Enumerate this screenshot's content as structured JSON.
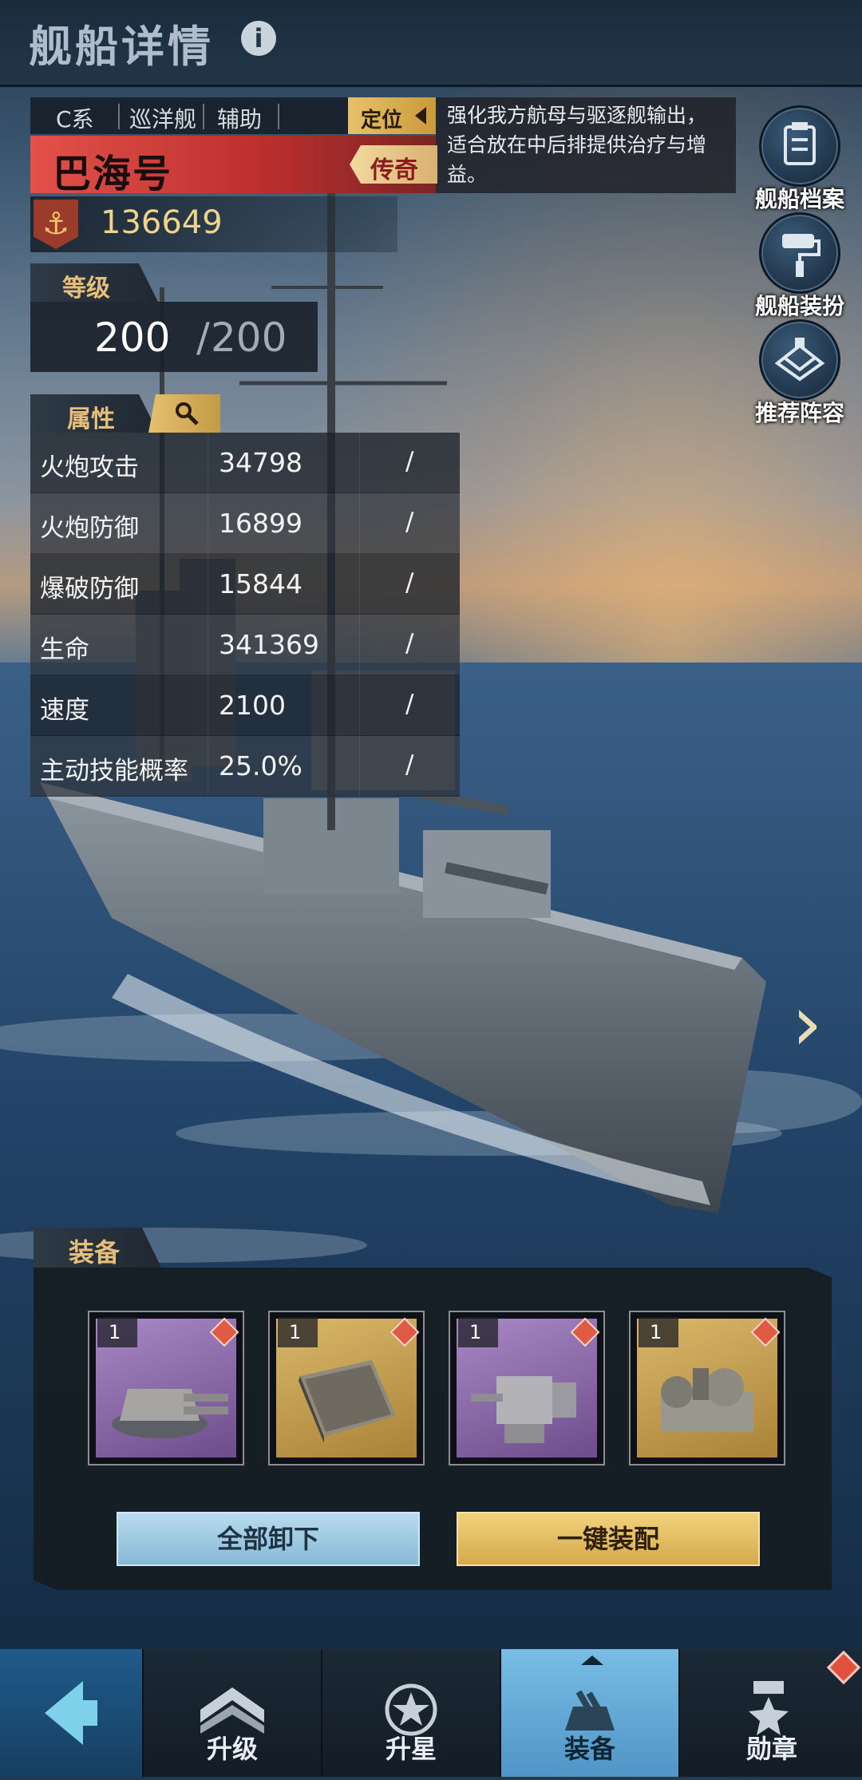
{
  "header": {
    "title": "舰船详情",
    "info_icon": "info-icon"
  },
  "ship": {
    "tags": [
      "C系",
      "巡洋舰",
      "辅助"
    ],
    "role_button": "定位",
    "description": "强化我方航母与驱逐舰输出，适合放在中后排提供治疗与增益。",
    "name": "巴海号",
    "rarity": "传奇",
    "power": "136649"
  },
  "level": {
    "label": "等级",
    "current": "200",
    "separator": "/",
    "max": "200"
  },
  "attributes": {
    "label": "属性",
    "rows": [
      {
        "name": "火炮攻击",
        "value": "34798",
        "bonus": "/"
      },
      {
        "name": "火炮防御",
        "value": "16899",
        "bonus": "/"
      },
      {
        "name": "爆破防御",
        "value": "15844",
        "bonus": "/"
      },
      {
        "name": "生命",
        "value": "341369",
        "bonus": "/"
      },
      {
        "name": "速度",
        "value": "2100",
        "bonus": "/"
      },
      {
        "name": "主动技能概率",
        "value": "25.0%",
        "bonus": "/"
      }
    ]
  },
  "side_buttons": [
    {
      "label": "舰船档案",
      "icon": "clipboard-icon"
    },
    {
      "label": "舰船装扮",
      "icon": "paint-roller-icon"
    },
    {
      "label": "推荐阵容",
      "icon": "ship-formation-icon"
    }
  ],
  "equipment": {
    "label": "装备",
    "slots": [
      {
        "count": "1",
        "icon": "turret-icon",
        "rarity_color": "#8c6aa8"
      },
      {
        "count": "1",
        "icon": "armor-plate-icon",
        "rarity_color": "#c49a46"
      },
      {
        "count": "1",
        "icon": "gun-mount-icon",
        "rarity_color": "#8c6aa8"
      },
      {
        "count": "1",
        "icon": "engine-icon",
        "rarity_color": "#c49a46"
      }
    ],
    "unload_all": "全部卸下",
    "auto_equip": "一键装配"
  },
  "bottom_nav": {
    "items": [
      {
        "label": "升级",
        "icon": "chevron-up-icon"
      },
      {
        "label": "升星",
        "icon": "star-emblem-icon"
      },
      {
        "label": "装备",
        "icon": "turret-nav-icon"
      },
      {
        "label": "勋章",
        "icon": "medal-icon"
      }
    ]
  }
}
